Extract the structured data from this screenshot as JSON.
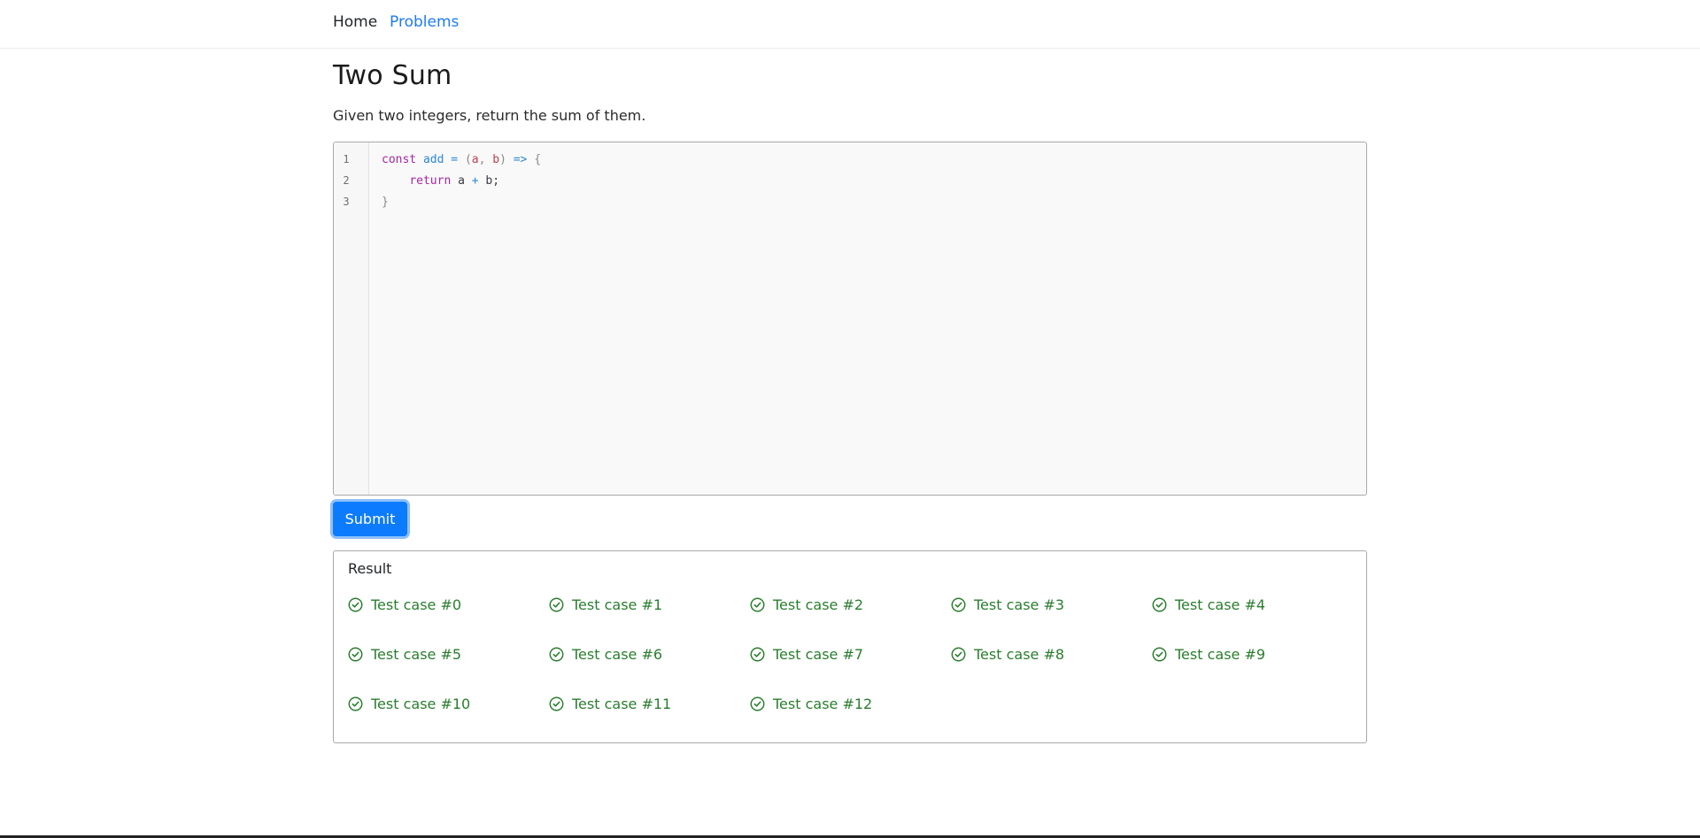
{
  "nav": {
    "home_label": "Home",
    "problems_label": "Problems"
  },
  "problem": {
    "title": "Two Sum",
    "description": "Given two integers, return the sum of them."
  },
  "editor": {
    "line_numbers": [
      "1",
      "2",
      "3"
    ],
    "code": {
      "line1": {
        "kw": "const",
        "fn": "add",
        "eq": "=",
        "open_paren": "(",
        "p1": "a",
        "comma": ",",
        "p2": "b",
        "close_paren": ")",
        "arrow": "=>",
        "brace": "{"
      },
      "line2": {
        "indent": "    ",
        "kw": "return",
        "a": "a",
        "plus": "+",
        "b": "b;"
      },
      "line3": {
        "brace": "}"
      }
    }
  },
  "actions": {
    "submit_label": "Submit"
  },
  "result": {
    "title": "Result",
    "status_color": "#2a7d2e",
    "icon": "check-circle-icon",
    "test_cases": [
      "Test case #0",
      "Test case #1",
      "Test case #2",
      "Test case #3",
      "Test case #4",
      "Test case #5",
      "Test case #6",
      "Test case #7",
      "Test case #8",
      "Test case #9",
      "Test case #10",
      "Test case #11",
      "Test case #12"
    ]
  },
  "colors": {
    "accent": "#0d7bfd",
    "link": "#1e7bf0",
    "success": "#2a7d2e"
  }
}
